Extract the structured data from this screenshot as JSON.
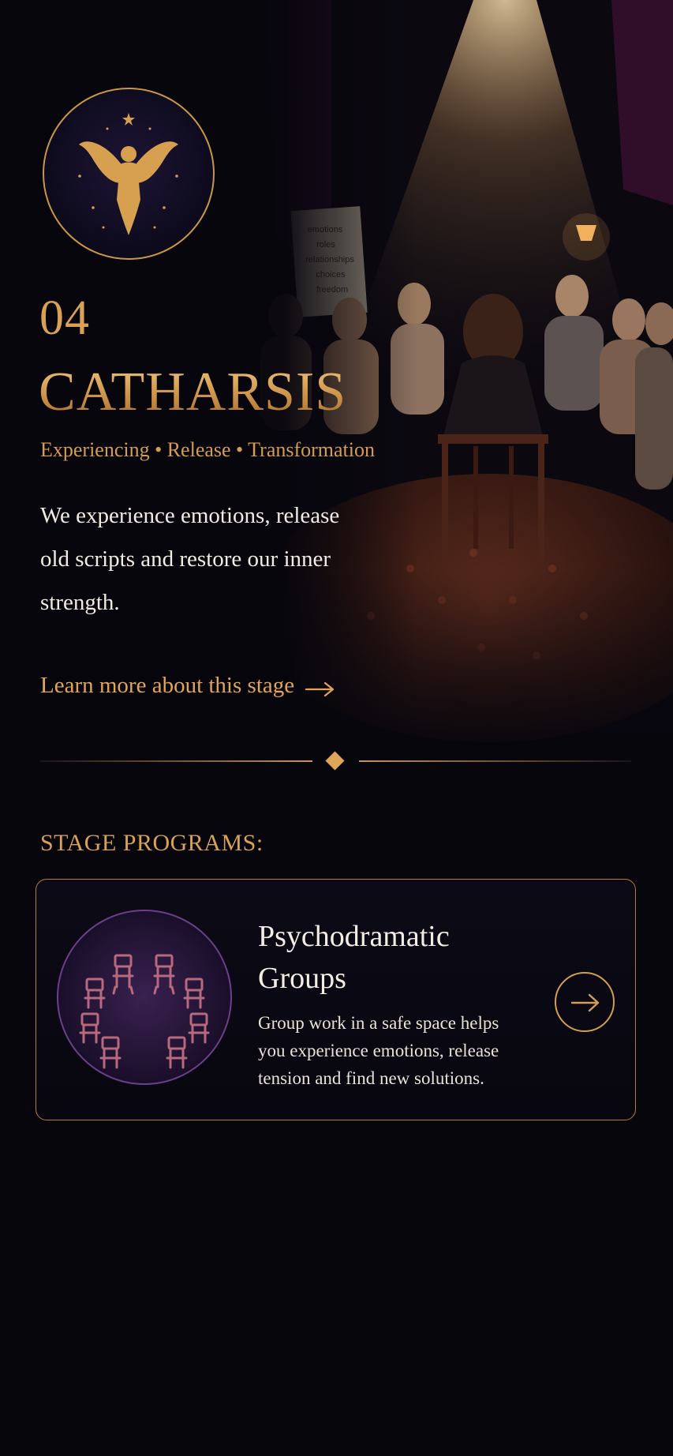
{
  "hero": {
    "emblem_icon": "winged-figure-emblem-icon",
    "board_lines": [
      "emotions",
      "roles",
      "relationships",
      "choices",
      "freedom"
    ],
    "stage_number": "04",
    "stage_title": "CATHARSIS",
    "keywords": "Experiencing • Release • Transformation",
    "description": "We experience emotions, release old scripts and restore our inner strength.",
    "learn_more_label": "Learn more about this stage",
    "learn_more_icon": "arrow-right-icon"
  },
  "programs": {
    "heading": "STAGE PROGRAMS:",
    "items": [
      {
        "title": "Psychodramatic Groups",
        "description": "Group work in a safe space helps you experience emotions, release tension and find new solutions.",
        "image_icon": "chair-circle-icon",
        "action_icon": "arrow-right-circle-icon"
      }
    ]
  },
  "colors": {
    "background": "#07060d",
    "gold": "#d9a155",
    "card_border": "#b07f3c",
    "purple_accent": "#6b3f8a"
  }
}
